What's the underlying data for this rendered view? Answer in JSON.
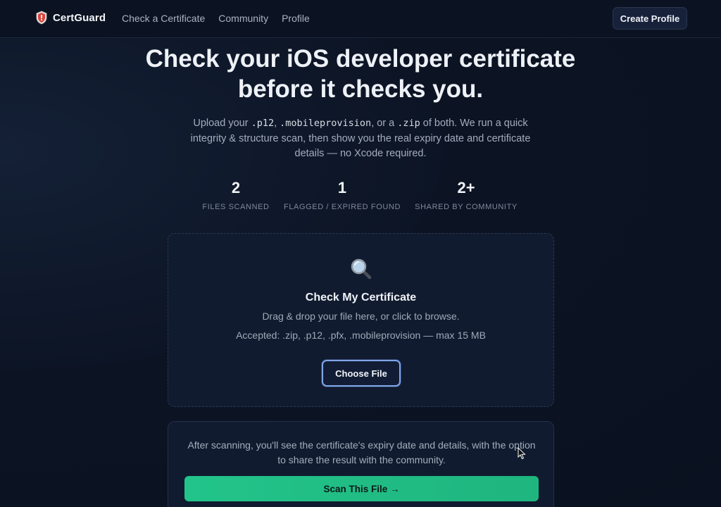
{
  "nav": {
    "brand": "CertGuard",
    "links": [
      "Check a Certificate",
      "Community",
      "Profile"
    ],
    "create_profile": "Create Profile"
  },
  "hero": {
    "title_line1": "Check your iOS developer certificate",
    "title_line2": "before it checks you.",
    "sub": {
      "t1": "Upload your ",
      "c1": ".p12",
      "t2": ", ",
      "c2": ".mobileprovision",
      "t3": ", or a ",
      "c3": ".zip",
      "t4": " of both. We run a quick integrity & structure scan, then show you the real expiry date and certificate details — no Xcode required."
    }
  },
  "stats": [
    {
      "value": "2",
      "label": "Files Scanned"
    },
    {
      "value": "1",
      "label": "Flagged / Expired Found"
    },
    {
      "value": "2+",
      "label": "Shared by Community"
    }
  ],
  "upload": {
    "title": "Check My Certificate",
    "hint": "Drag & drop your file here, or click to browse.",
    "accepted": "Accepted: .zip, .p12, .pfx, .mobileprovision — max 15 MB",
    "choose_button": "Choose File"
  },
  "scan": {
    "note": "After scanning, you'll see the certificate's expiry date and details, with the option to share the result with the community.",
    "button": "Scan This File →"
  },
  "colors": {
    "background": "#0a1120",
    "card": "#111b2f",
    "accent_green": "#22c48a",
    "focus_ring": "#7fa6e8"
  },
  "icons": {
    "brand": "shield-icon",
    "upload": "magnifying-glass-icon"
  }
}
